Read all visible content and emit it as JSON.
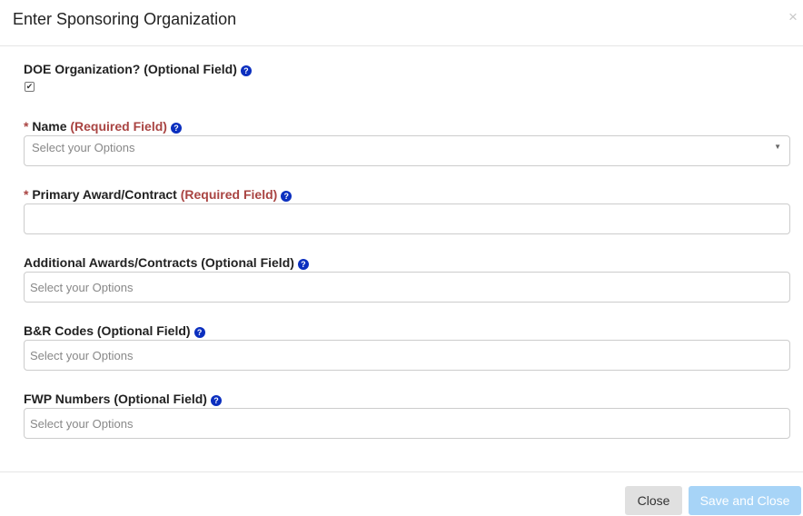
{
  "modal": {
    "title": "Enter Sponsoring Organization",
    "close_glyph": "×"
  },
  "fields": {
    "doe_org": {
      "label": "DOE Organization? (Optional Field)",
      "checked": true,
      "check_glyph": "✔"
    },
    "name": {
      "star": "*",
      "label": "Name",
      "req": "(Required Field)",
      "placeholder": "Select your Options",
      "caret": "▼"
    },
    "primary_award": {
      "star": "*",
      "label": "Primary Award/Contract",
      "req": "(Required Field)",
      "value": ""
    },
    "additional_awards": {
      "label": "Additional Awards/Contracts (Optional Field)",
      "placeholder": "Select your Options"
    },
    "br_codes": {
      "label": "B&R Codes (Optional Field)",
      "placeholder": "Select your Options"
    },
    "fwp_numbers": {
      "label": "FWP Numbers (Optional Field)",
      "placeholder": "Select your Options"
    }
  },
  "help_glyph": "?",
  "footer": {
    "close_label": "Close",
    "save_label": "Save and Close"
  },
  "colors": {
    "required": "#a94442",
    "help_icon": "#0b2fbf",
    "save_button_disabled": "#a7d4f7"
  },
  "icons": [
    "close-icon",
    "help-icon",
    "checkbox-check-icon",
    "dropdown-caret-icon"
  ]
}
